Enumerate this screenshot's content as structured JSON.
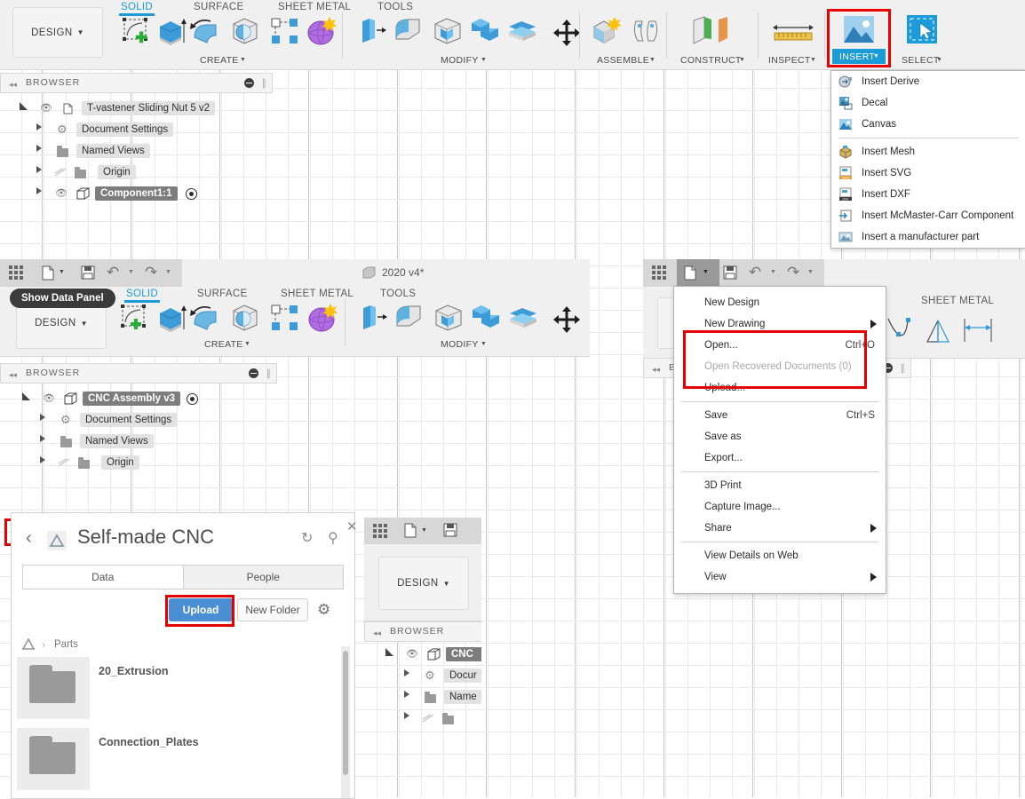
{
  "app": {
    "name": "Autodesk Fusion 360",
    "accent": "#1b9bd8",
    "annotation_color": "#e60000",
    "upload_button_color": "#4a8fd4"
  },
  "window1": {
    "design_button": "DESIGN",
    "ribbon_tabs": [
      {
        "label": "SOLID",
        "active": true
      },
      {
        "label": "SURFACE",
        "active": false
      },
      {
        "label": "SHEET METAL",
        "active": false
      },
      {
        "label": "TOOLS",
        "active": false
      }
    ],
    "groups": [
      {
        "label": "CREATE",
        "icons": [
          "create-sketch-icon",
          "extrude-icon",
          "revolve-icon",
          "sweep-icon",
          "pattern-icon",
          "form-icon"
        ]
      },
      {
        "label": "MODIFY",
        "icons": [
          "press-pull-icon",
          "fillet-icon",
          "shell-icon",
          "combine-icon",
          "offset-face-icon",
          "move-copy-icon"
        ]
      },
      {
        "label": "ASSEMBLE",
        "icons": [
          "new-component-icon",
          "joint-icon"
        ]
      },
      {
        "label": "CONSTRUCT",
        "icons": [
          "offset-plane-icon"
        ]
      },
      {
        "label": "INSPECT",
        "icons": [
          "measure-icon"
        ]
      },
      {
        "label": "INSERT",
        "icons": [
          "insert-image-icon"
        ],
        "highlighted": true,
        "annotated": true
      },
      {
        "label": "SELECT",
        "icons": [
          "select-window-icon"
        ]
      }
    ],
    "browser": {
      "title": "BROWSER",
      "tree": [
        {
          "label": "T-vastener Sliding Nut 5 v2",
          "icon": "document-icon",
          "depth": 0,
          "expanded": true,
          "eye": true,
          "selected": false
        },
        {
          "label": "Document Settings",
          "icon": "gear-icon",
          "depth": 1,
          "expanded": false,
          "eye": false,
          "selected": false
        },
        {
          "label": "Named Views",
          "icon": "folder-icon",
          "depth": 1,
          "expanded": false,
          "eye": false,
          "selected": false
        },
        {
          "label": "Origin",
          "icon": "folder-icon",
          "depth": 1,
          "expanded": false,
          "eye": false,
          "hidden_eye": true,
          "selected": false
        },
        {
          "label": "Component1:1",
          "icon": "component-icon",
          "depth": 1,
          "expanded": false,
          "eye": true,
          "selected": true,
          "radio": true
        }
      ]
    }
  },
  "insert_menu": {
    "items": [
      {
        "label": "Insert Derive",
        "icon": "insert-derive-icon",
        "separator_after": false
      },
      {
        "label": "Decal",
        "icon": "decal-icon",
        "separator_after": false
      },
      {
        "label": "Canvas",
        "icon": "canvas-icon",
        "separator_after": true
      },
      {
        "label": "Insert Mesh",
        "icon": "insert-mesh-icon",
        "separator_after": false
      },
      {
        "label": "Insert SVG",
        "icon": "insert-svg-icon",
        "separator_after": false
      },
      {
        "label": "Insert DXF",
        "icon": "insert-dxf-icon",
        "separator_after": false
      },
      {
        "label": "Insert McMaster-Carr Component",
        "icon": "mcmaster-carr-icon",
        "separator_after": false
      },
      {
        "label": "Insert a manufacturer part",
        "icon": "manufacturer-part-icon",
        "separator_after": false
      }
    ]
  },
  "window2": {
    "tab_title": "2020 v4*",
    "tooltip": "Show Data Panel",
    "design_button": "DESIGN",
    "quick_access": [
      "show-data-panel-icon",
      "file-menu-icon",
      "save-icon",
      "undo-icon",
      "redo-icon"
    ],
    "ribbon_tabs": [
      {
        "label": "SOLID",
        "active": true
      },
      {
        "label": "SURFACE",
        "active": false
      },
      {
        "label": "SHEET METAL",
        "active": false
      },
      {
        "label": "TOOLS",
        "active": false
      }
    ],
    "groups": [
      {
        "label": "CREATE"
      },
      {
        "label": "MODIFY"
      }
    ],
    "browser": {
      "title": "BROWSER",
      "tree": [
        {
          "label": "CNC Assembly v3",
          "icon": "component-icon",
          "depth": 0,
          "expanded": true,
          "eye": true,
          "selected": true,
          "radio": true
        },
        {
          "label": "Document Settings",
          "icon": "gear-icon",
          "depth": 1,
          "expanded": false,
          "eye": false,
          "selected": false
        },
        {
          "label": "Named Views",
          "icon": "folder-icon",
          "depth": 1,
          "expanded": false,
          "eye": false,
          "selected": false
        },
        {
          "label": "Origin",
          "icon": "folder-icon",
          "depth": 1,
          "expanded": false,
          "eye": false,
          "hidden_eye": true,
          "selected": false
        }
      ]
    }
  },
  "window3": {
    "quick_access": [
      "show-data-panel-icon",
      "file-menu-icon",
      "save-icon",
      "undo-icon",
      "redo-icon"
    ],
    "ribbon_tab_visible": "SHEET METAL",
    "browser": {
      "title": "BROWSER"
    }
  },
  "window4": {
    "design_button": "DESIGN",
    "quick_access": [
      "show-data-panel-icon",
      "file-menu-icon",
      "save-icon"
    ],
    "browser": {
      "title": "BROWSER",
      "tree": [
        {
          "label": "CNC",
          "icon": "component-icon",
          "depth": 0,
          "expanded": true,
          "eye": true,
          "selected": true
        },
        {
          "label": "Docur",
          "icon": "gear-icon",
          "depth": 1,
          "expanded": false,
          "eye": false,
          "selected": false
        },
        {
          "label": "Name",
          "icon": "folder-icon",
          "depth": 1,
          "expanded": false,
          "eye": false,
          "selected": false
        },
        {
          "label": "",
          "icon": "folder-icon",
          "depth": 1,
          "expanded": false,
          "eye": false,
          "hidden_eye": true,
          "selected": false
        }
      ]
    }
  },
  "file_menu": {
    "items": [
      {
        "label": "New Design",
        "shortcut": "",
        "submenu": false,
        "disabled": false,
        "separator_after": false
      },
      {
        "label": "New Drawing",
        "shortcut": "",
        "submenu": true,
        "disabled": false,
        "separator_after": false
      },
      {
        "label": "Open...",
        "shortcut": "Ctrl+O",
        "submenu": false,
        "disabled": false,
        "separator_after": false
      },
      {
        "label": "Open Recovered Documents (0)",
        "shortcut": "",
        "submenu": false,
        "disabled": true,
        "separator_after": false
      },
      {
        "label": "Upload...",
        "shortcut": "",
        "submenu": false,
        "disabled": false,
        "separator_after": true
      },
      {
        "label": "Save",
        "shortcut": "Ctrl+S",
        "submenu": false,
        "disabled": false,
        "separator_after": false
      },
      {
        "label": "Save as",
        "shortcut": "",
        "submenu": false,
        "disabled": false,
        "separator_after": false
      },
      {
        "label": "Export...",
        "shortcut": "",
        "submenu": false,
        "disabled": false,
        "separator_after": true
      },
      {
        "label": "3D Print",
        "shortcut": "",
        "submenu": false,
        "disabled": false,
        "separator_after": false
      },
      {
        "label": "Capture Image...",
        "shortcut": "",
        "submenu": false,
        "disabled": false,
        "separator_after": false
      },
      {
        "label": "Share",
        "shortcut": "",
        "submenu": true,
        "disabled": false,
        "separator_after": true
      },
      {
        "label": "View Details on Web",
        "shortcut": "",
        "submenu": false,
        "disabled": false,
        "separator_after": false
      },
      {
        "label": "View",
        "shortcut": "",
        "submenu": true,
        "disabled": false,
        "separator_after": false
      }
    ],
    "annotated_group": [
      "Open...",
      "Open Recovered Documents (0)",
      "Upload..."
    ]
  },
  "data_panel": {
    "project_title": "Self-made CNC",
    "back_icon": "chevron-left-icon",
    "project_logo": "autodesk-logo-icon",
    "refresh_icon": "refresh-icon",
    "search_icon": "search-icon",
    "close_icon": "close-icon",
    "tabs": [
      {
        "label": "Data",
        "active": true
      },
      {
        "label": "People",
        "active": false
      }
    ],
    "upload_button": "Upload",
    "new_folder_button": "New Folder",
    "settings_icon": "gear-icon",
    "breadcrumb_root_icon": "project-icon",
    "breadcrumb": "Parts",
    "items": [
      {
        "name": "20_Extrusion",
        "type": "folder"
      },
      {
        "name": "Connection_Plates",
        "type": "folder"
      }
    ]
  }
}
